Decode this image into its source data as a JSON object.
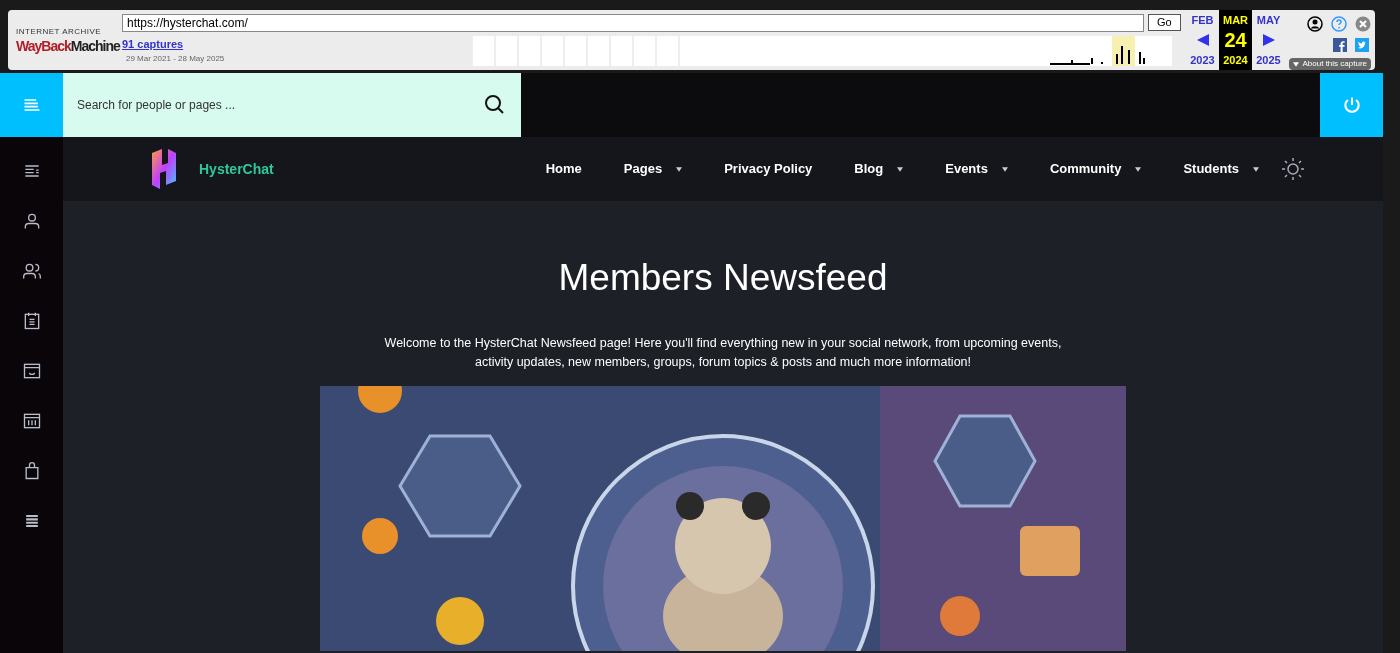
{
  "wayback": {
    "logo_top": "INTERNET ARCHIVE",
    "logo_red": "WayBack",
    "logo_dark": "Machine",
    "url": "https://hysterchat.com/",
    "go": "Go",
    "captures": "91 captures",
    "range": "29 Mar 2021 - 28 May 2025",
    "months": [
      {
        "month": "FEB",
        "year": "2023",
        "selected": false
      },
      {
        "month": "MAR",
        "day": "24",
        "year": "2024",
        "selected": true
      },
      {
        "month": "MAY",
        "year": "2025",
        "selected": false
      }
    ],
    "about": "About this capture"
  },
  "search": {
    "placeholder": "Search for people or pages ..."
  },
  "brand": "HysterChat",
  "nav": [
    {
      "label": "Home",
      "dropdown": false
    },
    {
      "label": "Pages",
      "dropdown": true
    },
    {
      "label": "Privacy Policy",
      "dropdown": false
    },
    {
      "label": "Blog",
      "dropdown": true
    },
    {
      "label": "Events",
      "dropdown": true
    },
    {
      "label": "Community",
      "dropdown": true
    },
    {
      "label": "Students",
      "dropdown": true
    }
  ],
  "sidebar": [
    {
      "kind": "toggle"
    },
    {
      "kind": "profile"
    },
    {
      "kind": "friends"
    },
    {
      "kind": "events"
    },
    {
      "kind": "groups"
    },
    {
      "kind": "forums"
    },
    {
      "kind": "shop"
    },
    {
      "kind": "more"
    }
  ],
  "heading": "Members Newsfeed",
  "intro": "Welcome to the HysterChat Newsfeed page! Here you'll find everything new in your social network, from upcoming events, activity updates, new members, groups, forum topics & posts and much more information!"
}
